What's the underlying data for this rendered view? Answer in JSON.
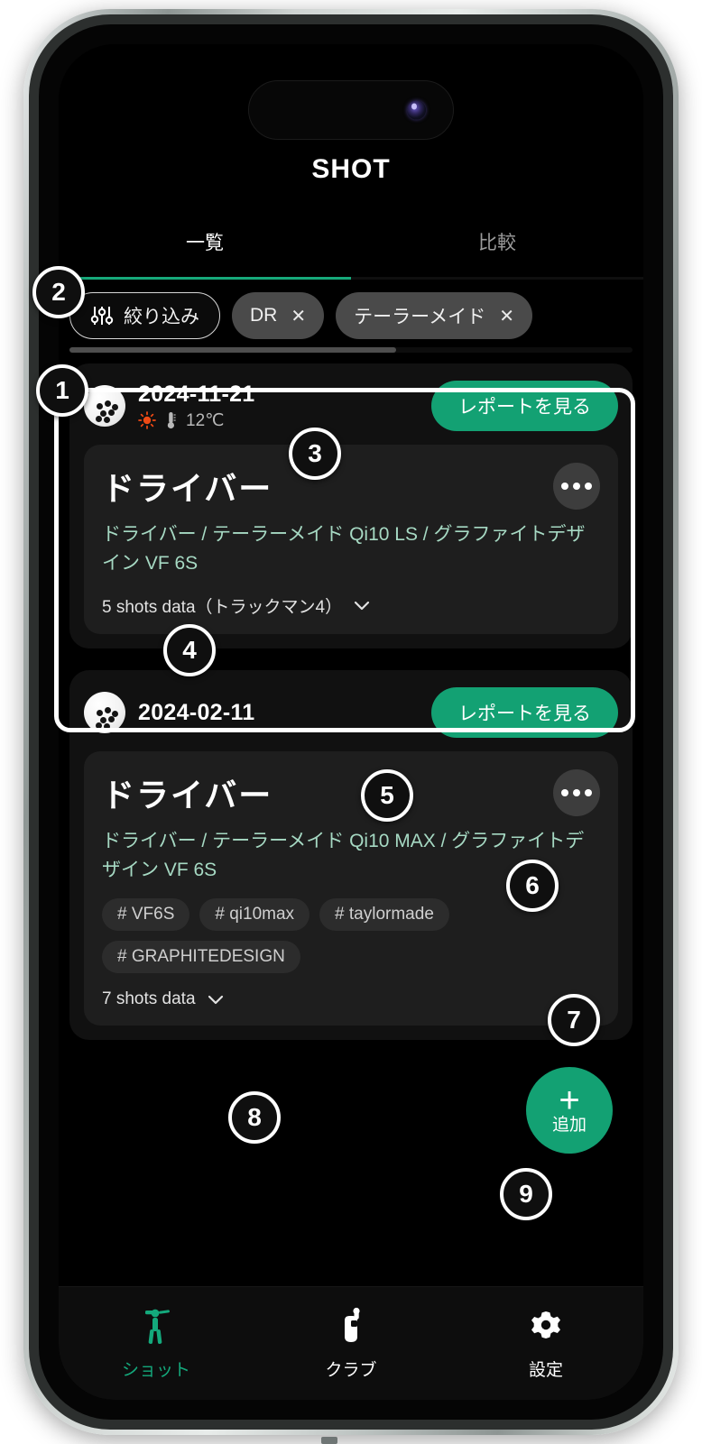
{
  "app": {
    "title": "SHOT",
    "tabs": [
      {
        "label": "一覧",
        "active": true
      },
      {
        "label": "比較",
        "active": false
      }
    ],
    "accent_color": "#13a173",
    "tab_indicator_color": "#16a97a",
    "background_color": "#000000"
  },
  "filters": {
    "filter_button_label": "絞り込み",
    "chips": [
      {
        "label": "DR",
        "close": "✕"
      },
      {
        "label": "テーラーメイド",
        "close": "✕"
      }
    ]
  },
  "cards": [
    {
      "date": "2024-11-21",
      "weather_icon": "sun-icon",
      "temperature": "12℃",
      "report_button_label": "レポートを見る",
      "club_name": "ドライバー",
      "club_spec": "ドライバー / テーラーメイド Qi10 LS / グラファイトデザイン VF 6S",
      "tags": [],
      "shots_label": "5 shots data（トラックマン4）",
      "menu_icon": "more-horizontal-icon",
      "expand_icon": "chevron-down-icon",
      "highlighted": true
    },
    {
      "date": "2024-02-11",
      "weather_icon": "",
      "temperature": "",
      "report_button_label": "レポートを見る",
      "club_name": "ドライバー",
      "club_spec": "ドライバー / テーラーメイド Qi10 MAX / グラファイトデザイン VF 6S",
      "tags": [
        "# VF6S",
        "# qi10max",
        "# taylormade",
        "# GRAPHITEDESIGN"
      ],
      "shots_label": "7 shots data",
      "menu_icon": "more-horizontal-icon",
      "expand_icon": "chevron-down-icon",
      "highlighted": false
    }
  ],
  "fab": {
    "icon": "plus-icon",
    "label": "追加"
  },
  "bottom_nav": [
    {
      "label": "ショット",
      "icon": "golfer-icon",
      "active": true
    },
    {
      "label": "クラブ",
      "icon": "golf-bag-icon",
      "active": false
    },
    {
      "label": "設定",
      "icon": "gear-icon",
      "active": false
    }
  ],
  "annotations": {
    "markers": [
      "1",
      "2",
      "3",
      "4",
      "5",
      "6",
      "7",
      "8",
      "9"
    ]
  }
}
